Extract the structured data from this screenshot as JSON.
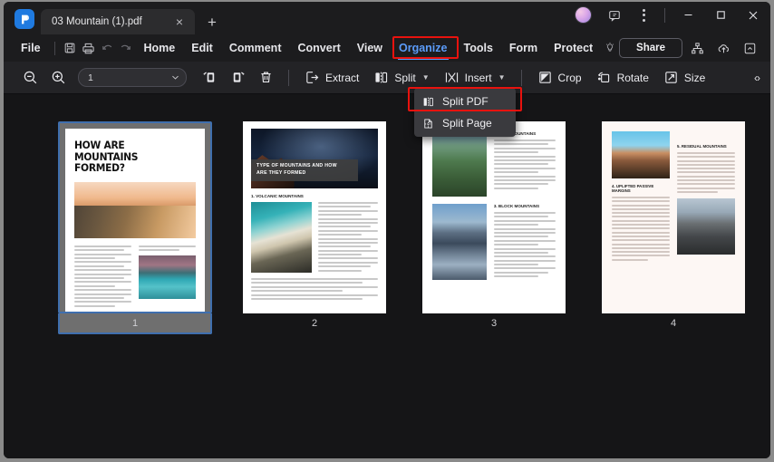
{
  "titlebar": {
    "logo_icon": "pdfelement-logo-icon",
    "tab_title": "03 Mountain (1).pdf",
    "tab_close_label": "×",
    "new_tab_label": "+",
    "avatar_label": "",
    "feedback_icon": "feedback-icon",
    "more_icon": "more-vertical-icon",
    "minimize_label": "—",
    "maximize_label": "☐",
    "close_label": "✕"
  },
  "menubar": {
    "file_label": "File",
    "quick_actions": [
      {
        "name": "save",
        "icon": "save-icon",
        "enabled": true
      },
      {
        "name": "print",
        "icon": "print-icon",
        "enabled": true
      },
      {
        "name": "undo",
        "icon": "undo-icon",
        "enabled": false
      },
      {
        "name": "redo",
        "icon": "redo-icon",
        "enabled": false
      }
    ],
    "items": [
      {
        "label": "Home",
        "active": false
      },
      {
        "label": "Edit",
        "active": false
      },
      {
        "label": "Comment",
        "active": false
      },
      {
        "label": "Convert",
        "active": false
      },
      {
        "label": "View",
        "active": false
      },
      {
        "label": "Organize",
        "active": true
      },
      {
        "label": "Tools",
        "active": false
      },
      {
        "label": "Form",
        "active": false
      },
      {
        "label": "Protect",
        "active": false
      }
    ],
    "bulb_icon": "lightbulb-icon",
    "share_label": "Share",
    "right_icons": [
      {
        "name": "sitemap-icon"
      },
      {
        "name": "cloud-upload-icon"
      },
      {
        "name": "collapse-ribbon-icon"
      }
    ]
  },
  "toolbar": {
    "zoom_out_icon": "zoom-out-icon",
    "zoom_in_icon": "zoom-in-icon",
    "page_number_value": "1",
    "page_number_caret": "▾",
    "rotate_left_icon": "rotate-page-left-icon",
    "rotate_right_icon": "rotate-page-right-icon",
    "delete_icon": "delete-page-icon",
    "items": [
      {
        "label": "Extract",
        "icon": "extract-icon",
        "caret": false
      },
      {
        "label": "Split",
        "icon": "split-icon",
        "caret": true
      },
      {
        "label": "Insert",
        "icon": "insert-icon",
        "caret": true
      },
      {
        "label": "Crop",
        "icon": "crop-icon",
        "caret": false
      },
      {
        "label": "Rotate",
        "icon": "rotate-icon",
        "caret": false
      },
      {
        "label": "Size",
        "icon": "size-icon",
        "caret": false
      }
    ],
    "overflow_label": "‹›"
  },
  "dropdown": {
    "open": true,
    "items": [
      {
        "label": "Split PDF",
        "icon": "split-pdf-icon",
        "highlighted": true
      },
      {
        "label": "Split Page",
        "icon": "split-page-icon",
        "highlighted": false
      }
    ]
  },
  "annotations": {
    "highlight_color": "#e8120e",
    "targets": [
      "Organize",
      "Split PDF"
    ]
  },
  "accent": {
    "brand_blue": "#1f7ae0",
    "active_tab_blue": "#5b9bf8",
    "selection_border": "#3f6fae"
  },
  "document": {
    "pages": [
      {
        "number": "1",
        "selected": true,
        "title": "HOW ARE MOUNTAINS FORMED?"
      },
      {
        "number": "2",
        "selected": false,
        "banner_line1": "TYPE OF MOUNTAINS AND HOW",
        "banner_line2": "ARE THEY FORMED",
        "section": "1. VOLCANIC MOUNTAINS"
      },
      {
        "number": "3",
        "selected": false,
        "section1": "2. FOLD MOUNTAINS",
        "section2": "3. BLOCK MOUNTAINS"
      },
      {
        "number": "4",
        "selected": false,
        "section1": "5. RESIDUAL MOUNTAINS",
        "section2": "4. UPLIFTED PASSIVE MARGINS"
      }
    ]
  }
}
